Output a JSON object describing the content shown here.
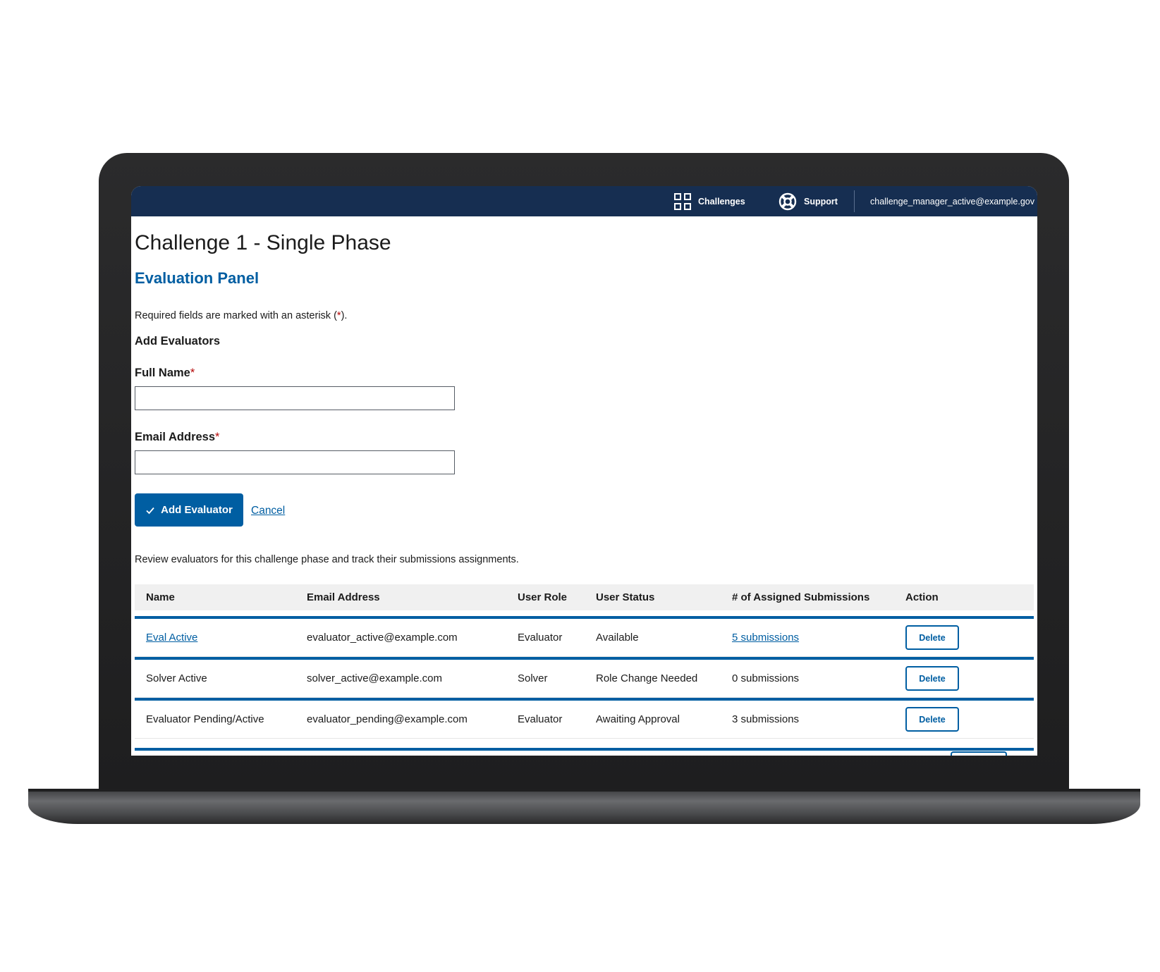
{
  "header": {
    "nav": [
      {
        "label": "Challenges",
        "icon": "grid-icon"
      },
      {
        "label": "Support",
        "icon": "lifebuoy-icon"
      }
    ],
    "user_email": "challenge_manager_active@example.gov"
  },
  "page": {
    "title": "Challenge 1 - Single Phase",
    "subtitle": "Evaluation Panel",
    "required_note_prefix": "Required fields are marked with an asterisk (",
    "required_note_asterisk": "*",
    "required_note_suffix": ").",
    "section_title": "Add Evaluators"
  },
  "form": {
    "full_name_label": "Full Name",
    "full_name_value": "",
    "email_label": "Email Address",
    "email_value": "",
    "required_marker": "*",
    "submit_label": "Add Evaluator",
    "cancel_label": "Cancel"
  },
  "review_text": "Review evaluators for this challenge phase and track their submissions assignments.",
  "table": {
    "headers": [
      "Name",
      "Email Address",
      "User Role",
      "User Status",
      "# of Assigned Submissions",
      "Action"
    ],
    "rows": [
      {
        "name": "Eval Active",
        "email": "evaluator_active@example.com",
        "role": "Evaluator",
        "status": "Available",
        "submissions": "5 submissions",
        "action": "Delete"
      },
      {
        "name": "Solver Active",
        "email": "solver_active@example.com",
        "role": "Solver",
        "status": "Role Change Needed",
        "submissions": "0 submissions",
        "action": "Delete"
      },
      {
        "name": "Evaluator Pending/Active",
        "email": "evaluator_pending@example.com",
        "role": "Evaluator",
        "status": "Awaiting Approval",
        "submissions": "3 submissions",
        "action": "Delete"
      }
    ]
  },
  "colors": {
    "header_bg": "#162e51",
    "primary": "#005ea2",
    "required": "#b50909"
  }
}
